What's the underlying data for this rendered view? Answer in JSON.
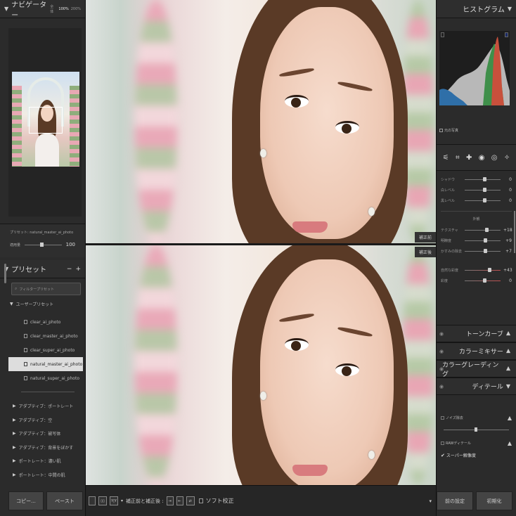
{
  "navigator": {
    "title": "ナビゲーター",
    "zoom_fit": "全体",
    "zoom_100": "100%",
    "zoom_200": "200%"
  },
  "preset_panel": {
    "preset_label": "プリセット: natural_master_ai_photo",
    "amount_label": "適用量",
    "amount_value": "100",
    "title": "プリセット",
    "minus": "−",
    "plus": "+",
    "search_placeholder": "フィルタープリセット",
    "user_group": "ユーザープリセット",
    "items": [
      {
        "label": "clear_ai_photo"
      },
      {
        "label": "clear_master_ai_photo"
      },
      {
        "label": "clear_super_ai_photo"
      },
      {
        "label": "natural_master_ai_photo"
      },
      {
        "label": "natural_super_ai_photo"
      }
    ],
    "groups": [
      {
        "label": "アダプティブ：ポートレート"
      },
      {
        "label": "アダプティブ：空"
      },
      {
        "label": "アダプティブ：被写体"
      },
      {
        "label": "アダプティブ：背景をぼかす"
      },
      {
        "label": "ポートレート：濃い肌"
      },
      {
        "label": "ポートレート：中間の肌"
      }
    ],
    "copy_button": "コピー...",
    "paste_button": "ペースト"
  },
  "center": {
    "after_tag": "補正前",
    "before_tag": "補正後"
  },
  "toolbar": {
    "yy": "Y|Y",
    "compare_label": "補正前と補正後 :",
    "soft_proof": "ソフト校正"
  },
  "histogram": {
    "title": "ヒストグラム",
    "original_photo": "元の写真"
  },
  "basic": {
    "sliders": [
      {
        "label": "シャドウ",
        "value": "0",
        "pos": 0.5
      },
      {
        "label": "白レベル",
        "value": "0",
        "pos": 0.5
      },
      {
        "label": "黒レベル",
        "value": "0",
        "pos": 0.5
      }
    ],
    "presence_label": "外観",
    "presence": [
      {
        "label": "テクスチャ",
        "value": "+18",
        "pos": 0.56
      },
      {
        "label": "明瞭度",
        "value": "+9",
        "pos": 0.53
      },
      {
        "label": "かすみの除去",
        "value": "+7",
        "pos": 0.52
      },
      {
        "label": "自然な彩度",
        "value": "+43",
        "pos": 0.64
      },
      {
        "label": "彩度",
        "value": "0",
        "pos": 0.5
      }
    ]
  },
  "sections": [
    {
      "label": "トーンカーブ"
    },
    {
      "label": "カラーミキサー"
    },
    {
      "label": "カラーグレーディング"
    },
    {
      "label": "ディテール"
    }
  ],
  "detail": {
    "noise_reduction": "ノイズ除去",
    "raw_detail": "RAWディテール",
    "super_resolution": "スーパー解像度"
  },
  "buttons": {
    "previous": "前の設定",
    "reset": "初期化"
  },
  "colors": {
    "accent_selected": "#dddddd",
    "panel_bg": "#2b2b2b"
  }
}
